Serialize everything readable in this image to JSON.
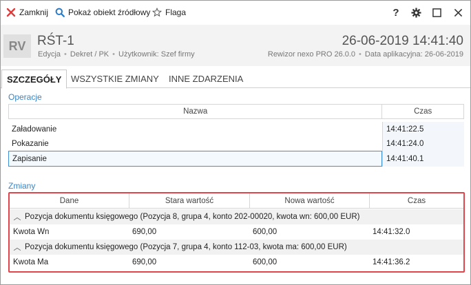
{
  "toolbar": {
    "close_label": "Zamknij",
    "show_source_label": "Pokaż obiekt źródłowy",
    "flag_label": "Flaga",
    "help_glyph": "?",
    "colors": {
      "close": "#e03a3a",
      "search": "#2a79c4"
    }
  },
  "header": {
    "avatar": "RV",
    "title": "RŚT-1",
    "sub": [
      "Edycja",
      "Dekret / PK",
      "Użytkownik: Szef firmy"
    ],
    "date": "26-06-2019 14:41:40",
    "meta": [
      "Rewizor nexo PRO 26.0.0",
      "Data aplikacyjna: 26-06-2019"
    ]
  },
  "tabs": [
    "SZCZEGÓŁY",
    "WSZYSTKIE ZMIANY",
    "INNE ZDARZENIA"
  ],
  "operations": {
    "section": "Operacje",
    "columns": [
      "Nazwa",
      "Czas"
    ],
    "rows": [
      [
        "Załadowanie",
        "14:41:22.5"
      ],
      [
        "Pokazanie",
        "14:41:24.0"
      ],
      [
        "Zapisanie",
        "14:41:40.1"
      ]
    ]
  },
  "changes": {
    "section": "Zmiany",
    "columns": [
      "Dane",
      "Stara wartość",
      "Nowa wartość",
      "Czas"
    ],
    "groups": [
      {
        "label": "Pozycja dokumentu księgowego (Pozycja 8, grupa 4, konto 202-00020, kwota wn: 600,00 EUR)",
        "row": [
          "Kwota Wn",
          "690,00",
          "600,00",
          "14:41:32.0"
        ]
      },
      {
        "label": "Pozycja dokumentu księgowego (Pozycja 7, grupa 4, konto 112-03, kwota ma: 600,00 EUR)",
        "row": [
          "Kwota Ma",
          "690,00",
          "600,00",
          "14:41:36.2"
        ]
      }
    ],
    "highlight_color": "#e0454b"
  },
  "accent_color": "#3a84c3"
}
